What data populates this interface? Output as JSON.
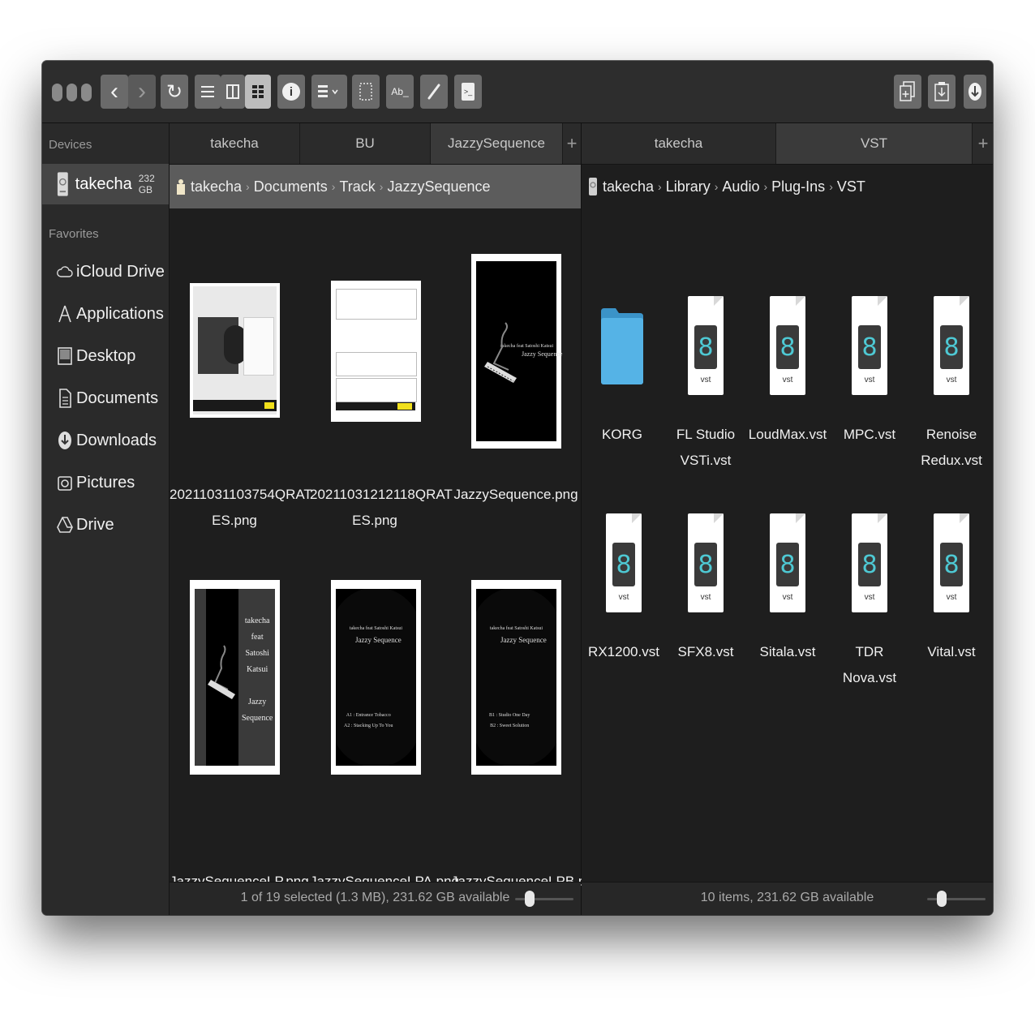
{
  "toolbar": {
    "back_label": "‹",
    "forward_label": "›",
    "refresh_label": "↻",
    "info_label": "i",
    "rename_label": "Ab_",
    "terminal_label": ">_"
  },
  "sidebar": {
    "devices_heading": "Devices",
    "device": {
      "name": "takecha",
      "size": "232 GB"
    },
    "favorites_heading": "Favorites",
    "items": [
      {
        "label": "iCloud Drive",
        "icon": "cloud-icon"
      },
      {
        "label": "Applications",
        "icon": "applications-icon"
      },
      {
        "label": "Desktop",
        "icon": "desktop-icon"
      },
      {
        "label": "Documents",
        "icon": "documents-icon"
      },
      {
        "label": "Downloads",
        "icon": "downloads-icon"
      },
      {
        "label": "Pictures",
        "icon": "pictures-icon"
      },
      {
        "label": "Drive",
        "icon": "drive-icon"
      }
    ],
    "add_label": "+"
  },
  "left_pane": {
    "tabs": [
      "takecha",
      "BU",
      "JazzySequence"
    ],
    "selected_tab": "JazzySequence",
    "path": [
      "takecha",
      "Documents",
      "Track",
      "JazzySequence"
    ],
    "files": [
      {
        "name_line1": "20211031103754QRAT",
        "name_line2": "ES.png"
      },
      {
        "name_line1": "20211031212118QRAT",
        "name_line2": "ES.png"
      },
      {
        "name_line1": "JazzySequence.png",
        "name_line2": ""
      },
      {
        "name_line1": "JazzySequenceLP.png",
        "name_line2": ""
      },
      {
        "name_line1": "JazzySequenceLPA.png",
        "name_line2": ""
      },
      {
        "name_line1": "JazzySequenceLPB.png",
        "name_line2": ""
      }
    ],
    "thumb_text": {
      "cover_small": "takecha feat Satoshi Katsui",
      "cover_title": "Jazzy Sequence",
      "lp_lines": [
        "takecha",
        "feat",
        "Satoshi",
        "Katsui",
        "",
        "Jazzy",
        "Sequence"
      ],
      "lpa_header": "takecha feat Satoshi Katsui",
      "lpa_title": "Jazzy Sequence",
      "lpa_tracks": [
        "A1 : Entrance Tobacco",
        "A2 : Stacking Up To You"
      ],
      "lpb_header": "takecha feat Satoshi Katsui",
      "lpb_title": "Jazzy Sequence",
      "lpb_tracks": [
        "B1 : Studio One Day",
        "B2 : Sweet Solution"
      ]
    },
    "status": "1 of 19 selected (1.3 MB), 231.62 GB available",
    "zoom_level": 0.25
  },
  "right_pane": {
    "tabs": [
      "takecha",
      "VST"
    ],
    "selected_tab": "VST",
    "path": [
      "takecha",
      "Library",
      "Audio",
      "Plug-Ins",
      "VST"
    ],
    "items": [
      {
        "kind": "folder",
        "name_line1": "KORG",
        "name_line2": ""
      },
      {
        "kind": "vst",
        "name_line1": "FL Studio",
        "name_line2": "VSTi.vst"
      },
      {
        "kind": "vst",
        "name_line1": "LoudMax.vst",
        "name_line2": ""
      },
      {
        "kind": "vst",
        "name_line1": "MPC.vst",
        "name_line2": ""
      },
      {
        "kind": "vst",
        "name_line1": "Renoise",
        "name_line2": "Redux.vst"
      },
      {
        "kind": "vst",
        "name_line1": "RX1200.vst",
        "name_line2": ""
      },
      {
        "kind": "vst",
        "name_line1": "SFX8.vst",
        "name_line2": ""
      },
      {
        "kind": "vst",
        "name_line1": "Sitala.vst",
        "name_line2": ""
      },
      {
        "kind": "vst",
        "name_line1": "TDR Nova.vst",
        "name_line2": ""
      },
      {
        "kind": "vst",
        "name_line1": "Vital.vst",
        "name_line2": ""
      }
    ],
    "doc_tag": "vst",
    "doc_glyph": "8",
    "status": "10 items, 231.62 GB available",
    "zoom_level": 0.25
  },
  "colors": {
    "window_bg": "#1e1e1e",
    "folder_blue": "#4aa8de",
    "vst_teal": "#4ec9d4"
  }
}
